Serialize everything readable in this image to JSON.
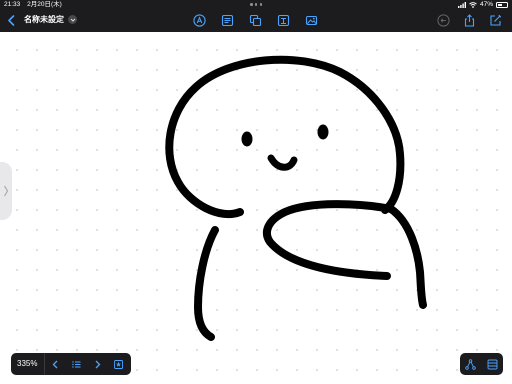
{
  "status_bar": {
    "time": "21:33",
    "date": "2月20日(木)",
    "battery": "47%"
  },
  "toolbar": {
    "title": "名称未設定"
  },
  "zoom_controls": {
    "zoom_level": "335%"
  },
  "colors": {
    "accent": "#4aa3ff",
    "toolbar_bg": "#1c1c1e",
    "ink": "#000000"
  },
  "icons": {
    "toolbar": [
      "back-chevron-icon",
      "pen-tool-icon",
      "text-box-icon",
      "shapes-icon",
      "typing-icon",
      "image-icon",
      "undo-icon",
      "share-icon",
      "compose-icon"
    ],
    "bottom": [
      "prev-page-icon",
      "page-list-icon",
      "next-page-icon",
      "favorite-icon",
      "connect-icon",
      "sidebar-panel-icon"
    ]
  }
}
